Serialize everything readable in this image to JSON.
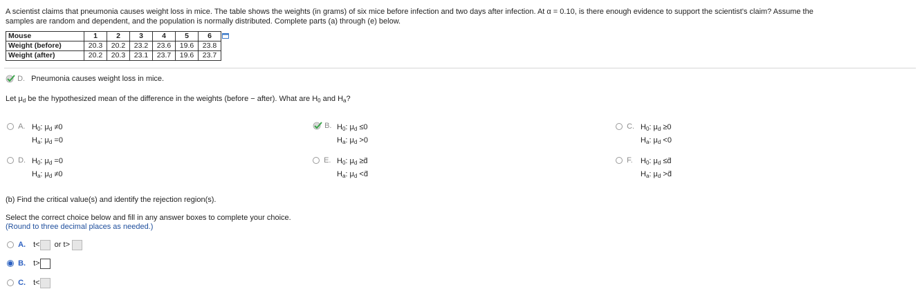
{
  "problem": {
    "intro_line1": "A scientist claims that pneumonia causes weight loss in mice. The table shows the weights (in grams) of six mice before infection and two days after infection. At α = 0.10, is there enough evidence to support the scientist's claim? Assume the",
    "intro_line2": "samples are random and dependent, and the population is normally distributed. Complete parts (a) through (e) below."
  },
  "table": {
    "row_labels": [
      "Mouse",
      "Weight (before)",
      "Weight (after)"
    ],
    "mouse": [
      "1",
      "2",
      "3",
      "4",
      "5",
      "6"
    ],
    "before": [
      "20.3",
      "20.2",
      "23.2",
      "23.6",
      "19.6",
      "23.8"
    ],
    "after": [
      "20.2",
      "20.3",
      "23.1",
      "23.7",
      "19.6",
      "23.7"
    ]
  },
  "part_a_claim": {
    "letter": "D.",
    "text": "Pneumonia causes weight loss in mice."
  },
  "hyp_question": {
    "prefix": "Let μ",
    "sub_d": "d",
    "mid": " be the hypothesized mean of the difference in the weights (before − after). What are H",
    "sub_0": "0",
    "and": " and H",
    "sub_a": "a",
    "end": "?"
  },
  "hyp_options": [
    {
      "letter": "A.",
      "h0": "≠0",
      "ha": "=0"
    },
    {
      "letter": "B.",
      "h0": "≤0",
      "ha": ">0"
    },
    {
      "letter": "C.",
      "h0": "≥0",
      "ha": "<0"
    },
    {
      "letter": "D.",
      "h0": "=0",
      "ha": "≠0"
    },
    {
      "letter": "E.",
      "h0": "≥d̄",
      "ha": "<d̄"
    },
    {
      "letter": "F.",
      "h0": "≤d̄",
      "ha": ">d̄"
    }
  ],
  "part_b": {
    "title": "(b) Find the critical value(s) and identify the rejection region(s).",
    "instruction": "Select the correct choice below and fill in any answer boxes to complete your choice.",
    "round_note": "(Round to three decimal places as needed.)",
    "options": [
      {
        "letter": "A.",
        "text1": "t<",
        "text2": "or t>"
      },
      {
        "letter": "B.",
        "text1": "t>"
      },
      {
        "letter": "C.",
        "text1": "t<"
      }
    ]
  },
  "symbols": {
    "H": "H",
    "mu": "μ",
    "colon": ":"
  }
}
